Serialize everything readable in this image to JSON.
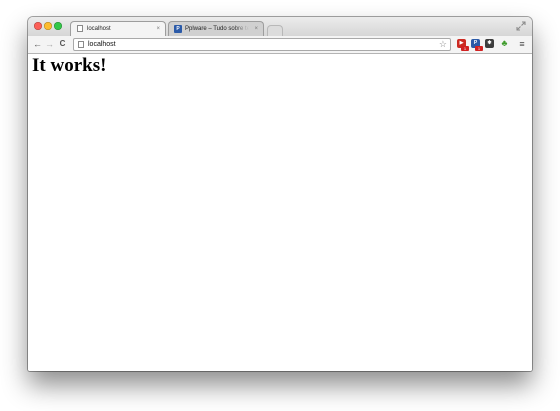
{
  "browser": {
    "tabs": [
      {
        "title": "localhost",
        "close": "×"
      },
      {
        "title": "Pplware – Tudo sobre tecnologia",
        "close": "×",
        "favicon_text": "P"
      }
    ],
    "toolbar": {
      "back": "←",
      "forward": "→",
      "reload": "C",
      "url": "localhost",
      "star": "☆",
      "menu": "≡"
    },
    "extensions": {
      "youtube_badge": "1",
      "pplware_badge": "1",
      "pplware_glyph": "P"
    }
  },
  "page": {
    "heading": "It works!"
  },
  "colors": {
    "tab_active": "#f4f4f4",
    "tab_inactive": "#d0d0d0",
    "titlebar": "#d6d6d6",
    "close": "#fc5f57",
    "minimize": "#fdbc2e",
    "maximize": "#33c748"
  }
}
